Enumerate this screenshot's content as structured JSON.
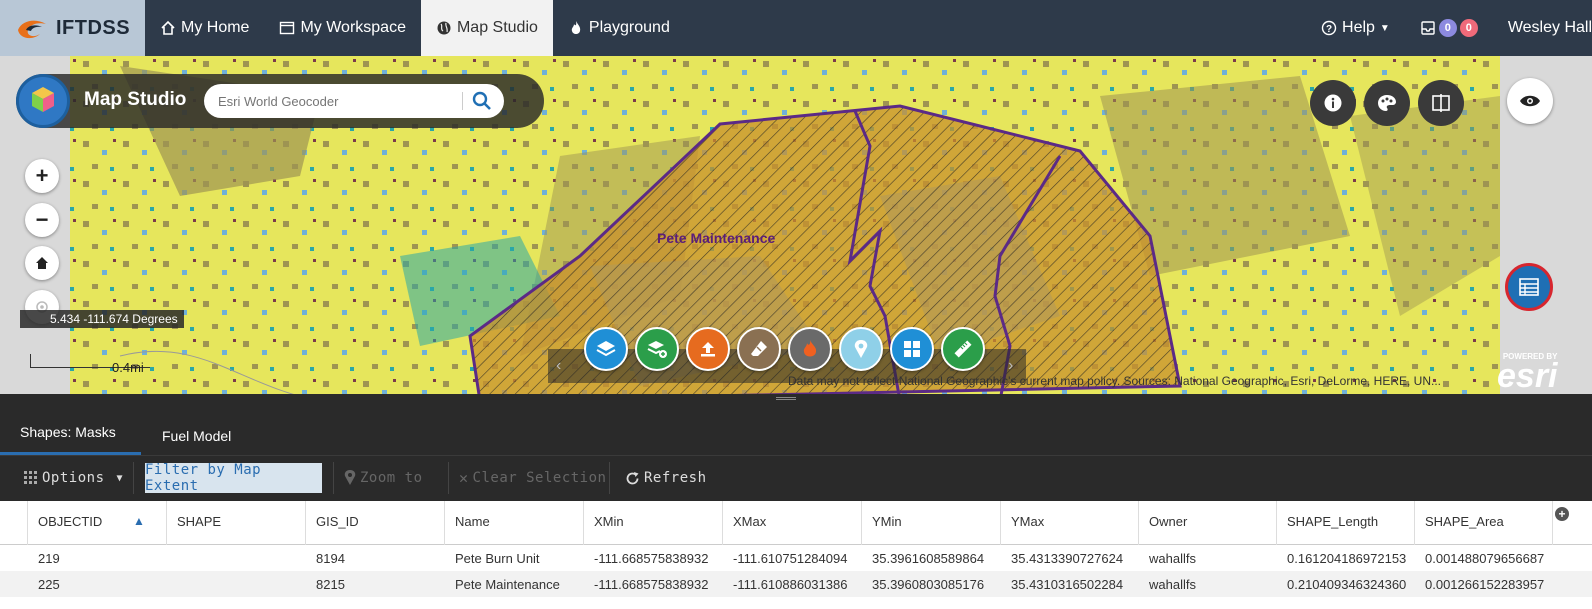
{
  "navbar": {
    "brand": "IFTDSS",
    "items": [
      {
        "label": "My Home"
      },
      {
        "label": "My Workspace"
      },
      {
        "label": "Map Studio"
      },
      {
        "label": "Playground"
      }
    ],
    "help": "Help",
    "badge_a": "0",
    "badge_b": "0",
    "user": "Wesley Hall"
  },
  "map": {
    "app_title": "Map Studio",
    "search_placeholder": "Esri World Geocoder",
    "coords": "5.434 -111.674 Degrees",
    "scale": "0.4mi",
    "feature_label": "Pete Maintenance",
    "attribution": "Data may not reflect National Geographic's current map policy. Sources: National Geographic, Esri, DeLorme, HERE, UN...",
    "esri_powered": "POWERED BY",
    "esri": "esri"
  },
  "tabs": [
    {
      "label": "Shapes: Masks"
    },
    {
      "label": "Fuel Model"
    }
  ],
  "toolbar": {
    "options": "Options",
    "filter": "Filter by Map Extent",
    "zoom_to": "Zoom to",
    "clear": "Clear Selection",
    "refresh": "Refresh"
  },
  "grid": {
    "columns": [
      "OBJECTID",
      "SHAPE",
      "GIS_ID",
      "Name",
      "XMin",
      "XMax",
      "YMin",
      "YMax",
      "Owner",
      "SHAPE_Length",
      "SHAPE_Area"
    ],
    "rows": [
      [
        "219",
        "",
        "8194",
        "Pete Burn Unit",
        "-111.668575838932",
        "-111.610751284094",
        "35.3961608589864",
        "35.4313390727624",
        "wahallfs",
        "0.161204186972153",
        "0.001488079656687"
      ],
      [
        "225",
        "",
        "8215",
        "Pete Maintenance",
        "-111.668575838932",
        "-111.610886031386",
        "35.3960803085176",
        "35.4310316502284",
        "wahallfs",
        "0.210409346324360",
        "0.001266152283957"
      ]
    ]
  },
  "colors": {
    "nav_bg": "#2e3a4a",
    "accent": "#2a6db0",
    "boundary": "#5b2a86"
  }
}
